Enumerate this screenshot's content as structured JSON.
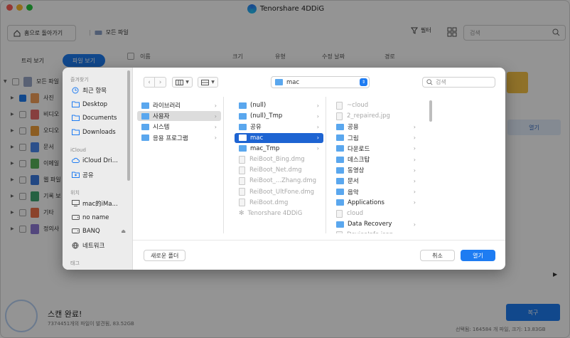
{
  "app": {
    "title": "Tenorshare 4DDiG",
    "colors": {
      "accent": "#1e7cf2",
      "light_red": "#fe5f57",
      "light_yellow": "#febc2e",
      "light_green": "#28c840"
    },
    "toolbar": {
      "home_label": "홈으로 돌아가기",
      "path_label": "모든 파일",
      "filter_label": "필터",
      "search_placeholder": "검색"
    },
    "view_tabs": {
      "tree": "트리 보기",
      "file": "파일 보기"
    },
    "columns": [
      "이름",
      "크기",
      "유형",
      "수정 날짜",
      "경로"
    ],
    "tree": [
      {
        "label": "모든 파일",
        "checked": false,
        "color": "#9aa7c9"
      },
      {
        "label": "사진",
        "checked": true,
        "color": "#f5a15a"
      },
      {
        "label": "비디오",
        "checked": false,
        "color": "#e96b6b"
      },
      {
        "label": "오디오",
        "checked": false,
        "color": "#f1a13b"
      },
      {
        "label": "문서",
        "checked": false,
        "color": "#4d8bf0"
      },
      {
        "label": "이메일",
        "checked": false,
        "color": "#58b35b"
      },
      {
        "label": "웹 파일",
        "checked": false,
        "color": "#3a7be2"
      },
      {
        "label": "기록 보",
        "checked": false,
        "color": "#41a872"
      },
      {
        "label": "기타",
        "checked": false,
        "color": "#f0744a"
      },
      {
        "label": "정의사",
        "checked": false,
        "color": "#8f7ad8"
      }
    ],
    "right_open_label": "열기",
    "scan": {
      "title": "스캔 완료!",
      "info": "7374451개의 파일이 발견됨, 83.52GB"
    },
    "recover_label": "복구",
    "selection_info": "선택됨: 164584 개 파일, 크기: 13.83GB"
  },
  "dialog": {
    "sidebar": {
      "favorites_header": "즐겨찾기",
      "favorites": [
        {
          "label": "최근 항목",
          "icon": "clock-icon"
        },
        {
          "label": "Desktop",
          "icon": "folder-icon"
        },
        {
          "label": "Documents",
          "icon": "folder-icon"
        },
        {
          "label": "Downloads",
          "icon": "folder-icon"
        }
      ],
      "icloud_header": "iCloud",
      "icloud": [
        {
          "label": "iCloud Dri...",
          "icon": "cloud-icon"
        },
        {
          "label": "공유",
          "icon": "shared-folder-icon"
        }
      ],
      "locations_header": "위치",
      "locations": [
        {
          "label": "mac的iMa...",
          "icon": "computer-icon"
        },
        {
          "label": "no name",
          "icon": "drive-icon"
        },
        {
          "label": "BANQ",
          "icon": "drive-icon",
          "eject": "⏏"
        },
        {
          "label": "네트워크",
          "icon": "network-icon"
        }
      ],
      "tags_header": "태그"
    },
    "location": "mac",
    "search_placeholder": "검색",
    "columns": [
      [
        {
          "label": "라이브러리",
          "kind": "folder",
          "chevron": true
        },
        {
          "label": "사용자",
          "kind": "folder",
          "chevron": true,
          "highlight": true
        },
        {
          "label": "시스템",
          "kind": "folder",
          "chevron": true
        },
        {
          "label": "응용 프로그램",
          "kind": "folder",
          "chevron": true
        }
      ],
      [
        {
          "label": "(null)",
          "kind": "folder",
          "chevron": true
        },
        {
          "label": "(null)_Tmp",
          "kind": "folder",
          "chevron": true
        },
        {
          "label": "공유",
          "kind": "folder",
          "chevron": true
        },
        {
          "label": "mac",
          "kind": "folder",
          "chevron": true,
          "selected": true
        },
        {
          "label": "mac_Tmp",
          "kind": "folder",
          "chevron": true
        },
        {
          "label": "ReiBoot_Bing.dmg",
          "kind": "file",
          "dim": true
        },
        {
          "label": "ReiBoot_Net.dmg",
          "kind": "file",
          "dim": true
        },
        {
          "label": "ReiBoot_...Zhang.dmg",
          "kind": "file",
          "dim": true
        },
        {
          "label": "ReiBoot_UltFone.dmg",
          "kind": "file",
          "dim": true
        },
        {
          "label": "ReiBoot.dmg",
          "kind": "file",
          "dim": true
        },
        {
          "label": "Tenorshare 4DDiG",
          "kind": "app",
          "dim": true
        }
      ],
      [
        {
          "label": "~cloud",
          "kind": "file",
          "dim": true
        },
        {
          "label": "2_repaired.jpg",
          "kind": "file",
          "dim": true
        },
        {
          "label": "공용",
          "kind": "folder",
          "chevron": true
        },
        {
          "label": "그림",
          "kind": "folder",
          "chevron": true
        },
        {
          "label": "다운로드",
          "kind": "folder",
          "chevron": true
        },
        {
          "label": "데스크탑",
          "kind": "folder",
          "chevron": true
        },
        {
          "label": "동영상",
          "kind": "folder",
          "chevron": true
        },
        {
          "label": "문서",
          "kind": "folder",
          "chevron": true
        },
        {
          "label": "음악",
          "kind": "folder",
          "chevron": true
        },
        {
          "label": "Applications",
          "kind": "folder",
          "chevron": true
        },
        {
          "label": "cloud",
          "kind": "file",
          "dim": true
        },
        {
          "label": "Data Recovery",
          "kind": "folder",
          "chevron": true
        },
        {
          "label": "DeviceInfo.json",
          "kind": "file",
          "dim": true
        }
      ]
    ],
    "new_folder_label": "새로운 폴더",
    "cancel_label": "취소",
    "open_label": "열기"
  }
}
